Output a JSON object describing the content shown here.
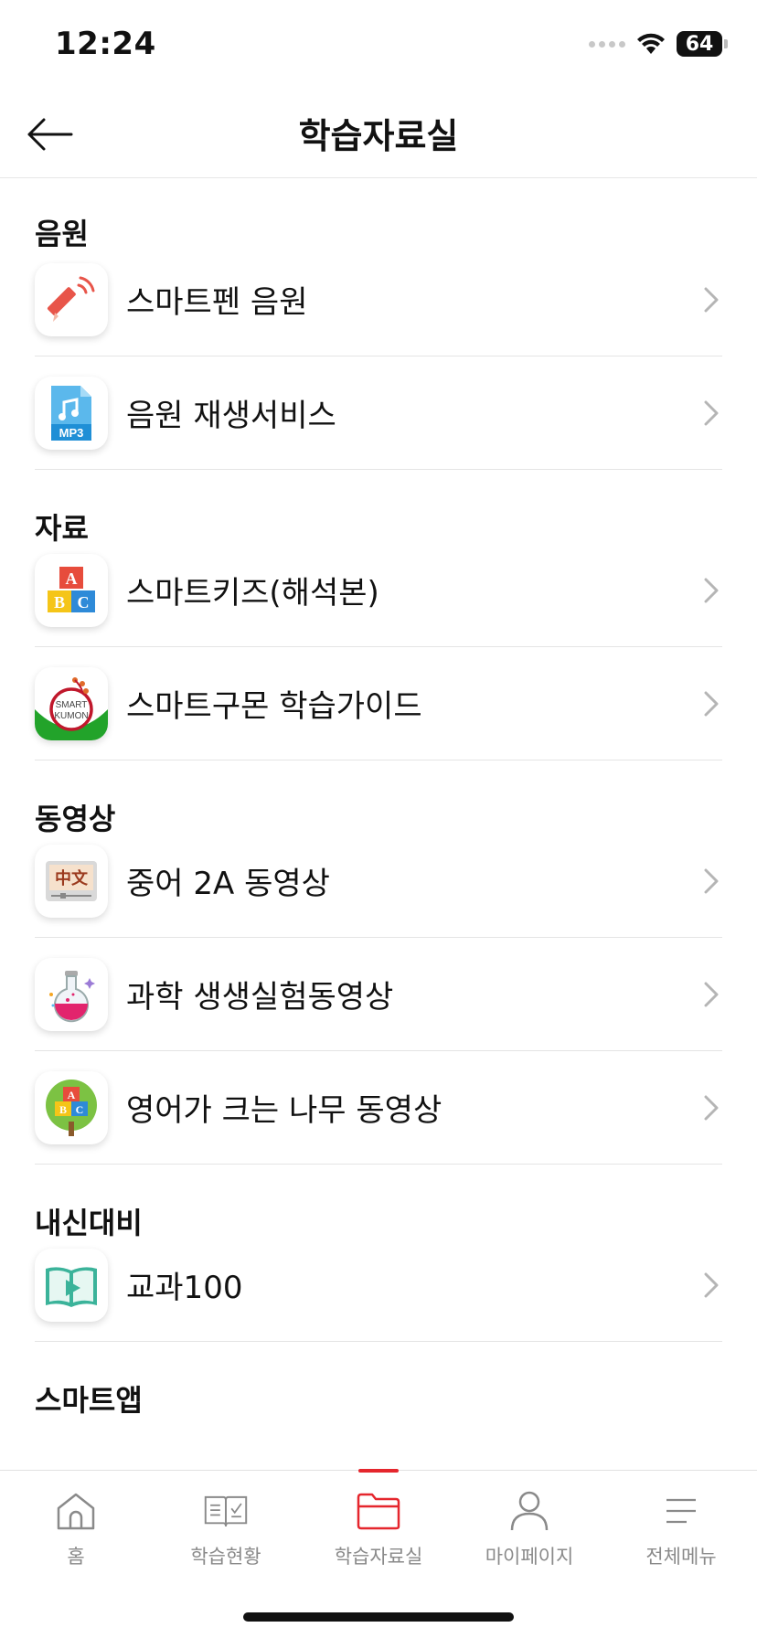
{
  "status_bar": {
    "time": "12:24",
    "battery": "64"
  },
  "header": {
    "title": "학습자료실",
    "back_icon": "arrow-left-icon"
  },
  "sections": [
    {
      "title": "음원",
      "items": [
        {
          "label": "스마트펜 음원",
          "icon": "smart-pen-icon"
        },
        {
          "label": "음원 재생서비스",
          "icon": "mp3-file-icon"
        }
      ]
    },
    {
      "title": "자료",
      "items": [
        {
          "label": "스마트키즈(해석본)",
          "icon": "abc-blocks-icon"
        },
        {
          "label": "스마트구몬 학습가이드",
          "icon": "smart-kumon-logo-icon"
        }
      ]
    },
    {
      "title": "동영상",
      "items": [
        {
          "label": "중어 2A 동영상",
          "icon": "chinese-video-icon"
        },
        {
          "label": "과학 생생실험동영상",
          "icon": "science-flask-icon"
        },
        {
          "label": "영어가 크는 나무 동영상",
          "icon": "english-tree-icon"
        }
      ]
    },
    {
      "title": "내신대비",
      "items": [
        {
          "label": "교과100",
          "icon": "play-book-icon"
        }
      ]
    },
    {
      "title": "스마트앱",
      "items": []
    }
  ],
  "icon_text": {
    "mp3": "MP3",
    "abc_a": "A",
    "abc_b": "B",
    "abc_c": "C",
    "kumon_line1": "SMART",
    "kumon_line2": "KUMON",
    "chinese": "中文"
  },
  "tabs": [
    {
      "label": "홈",
      "icon": "home-icon",
      "active": false
    },
    {
      "label": "학습현황",
      "icon": "study-status-icon",
      "active": false
    },
    {
      "label": "학습자료실",
      "icon": "folder-icon",
      "active": true
    },
    {
      "label": "마이페이지",
      "icon": "person-icon",
      "active": false
    },
    {
      "label": "전체메뉴",
      "icon": "menu-icon",
      "active": false
    }
  ],
  "colors": {
    "accent": "#e5262d",
    "text": "#111111",
    "muted": "#8a8a8a",
    "divider": "#e4e4e4"
  }
}
